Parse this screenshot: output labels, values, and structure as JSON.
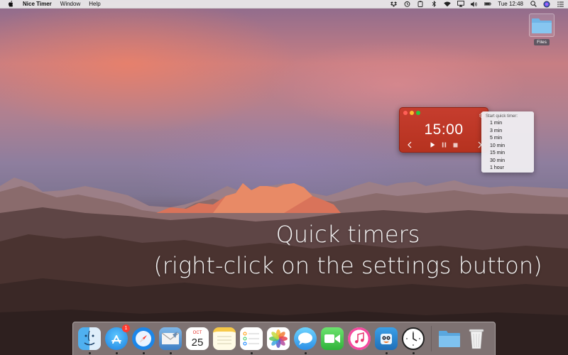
{
  "menubar": {
    "app_name": "Nice Timer",
    "menus": [
      "Window",
      "Help"
    ],
    "clock": "Tue 12:48",
    "status_icons": [
      "dropbox-icon",
      "timer-icon",
      "clipboard-icon",
      "bluetooth-icon",
      "wifi-icon",
      "airplay-icon",
      "volume-icon",
      "battery-icon",
      "search-icon",
      "siri-icon",
      "notification-center-icon"
    ]
  },
  "desktop": {
    "items": [
      {
        "label": "Files",
        "icon": "folder-icon"
      }
    ]
  },
  "timer": {
    "time": "15:00",
    "color": "#c63d2e"
  },
  "context_menu": {
    "header": "Start quick timer:",
    "items": [
      "1 min",
      "3 min",
      "5 min",
      "10 min",
      "15 min",
      "30 min",
      "1 hour"
    ]
  },
  "caption": {
    "line1": "Quick timers",
    "line2": "(right-click on the settings button)"
  },
  "dock": {
    "apps": [
      {
        "name": "finder-icon",
        "running": true
      },
      {
        "name": "app-store-icon",
        "running": true,
        "badge": "1"
      },
      {
        "name": "safari-icon",
        "running": true
      },
      {
        "name": "mail-icon",
        "running": true
      },
      {
        "name": "calendar-icon",
        "running": false,
        "month": "OCT",
        "day": "25"
      },
      {
        "name": "notes-icon",
        "running": false
      },
      {
        "name": "reminders-icon",
        "running": true
      },
      {
        "name": "photos-icon",
        "running": false
      },
      {
        "name": "messages-icon",
        "running": true
      },
      {
        "name": "facetime-icon",
        "running": false
      },
      {
        "name": "itunes-icon",
        "running": false
      },
      {
        "name": "tweetbot-icon",
        "running": true
      },
      {
        "name": "nice-timer-icon",
        "running": true
      }
    ],
    "trailing": [
      {
        "name": "downloads-folder-icon",
        "running": false
      },
      {
        "name": "trash-icon",
        "running": false
      }
    ]
  }
}
